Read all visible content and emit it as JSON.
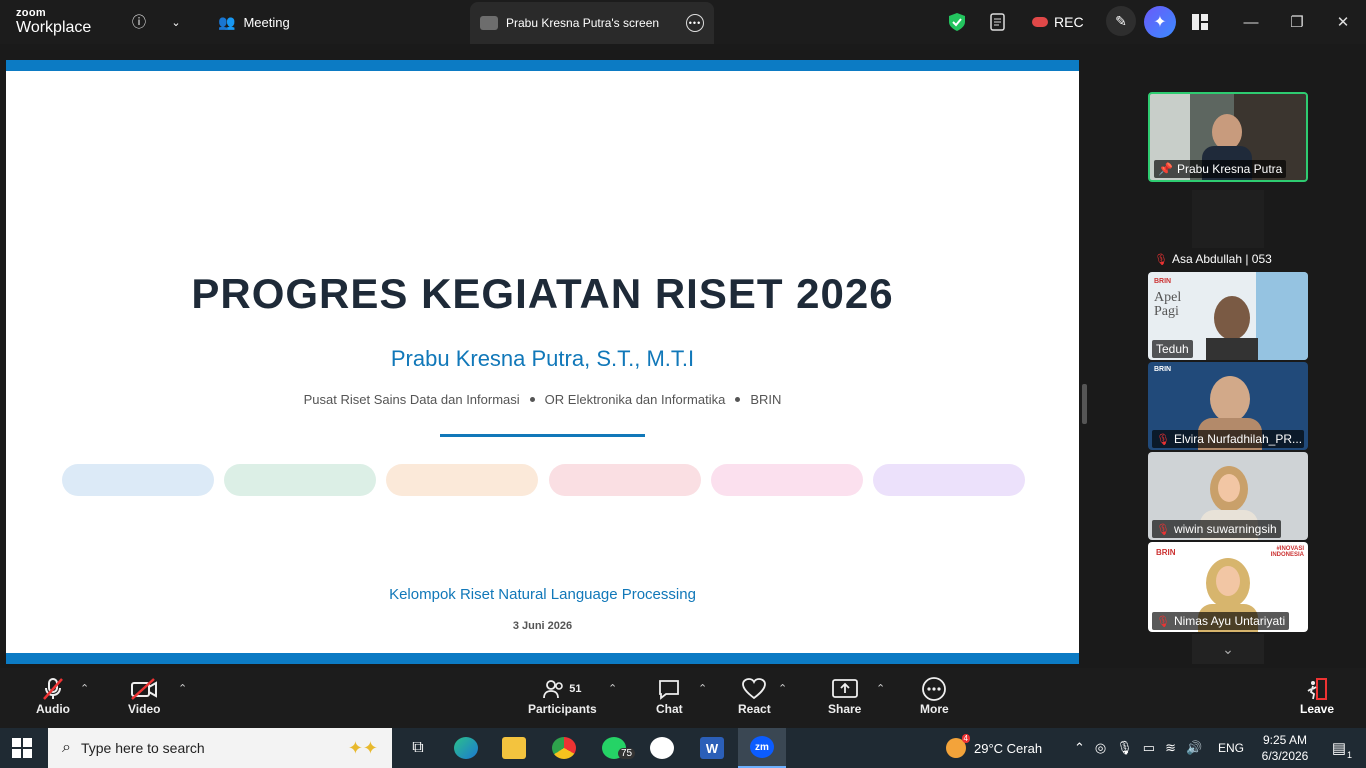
{
  "app": {
    "brand_top": "zoom",
    "brand_bottom": "Workplace"
  },
  "topbar": {
    "meeting_tab": "Meeting",
    "share_tab": "Prabu Kresna Putra's screen",
    "rec_label": "REC"
  },
  "slide": {
    "title": "PROGRES KEGIATAN RISET 2026",
    "author": "Prabu Kresna Putra, S.T., M.T.I",
    "affiliations": [
      "Pusat Riset Sains Data dan Informasi",
      "OR Elektronika dan Informatika",
      "BRIN"
    ],
    "pill_colors": [
      "#dceaf7",
      "#dcefe6",
      "#fbe9d9",
      "#fadfe3",
      "#fbe0ee",
      "#ece1fb"
    ],
    "group": "Kelompok Riset Natural Language Processing",
    "date": "3 Juni  2026"
  },
  "gallery": {
    "active_speaker": "Prabu Kresna Putra",
    "tiles": [
      {
        "name": "Asa Abdullah | 053"
      },
      {
        "name": "Teduh"
      },
      {
        "name": "Elvira Nurfadhilah_PR..."
      },
      {
        "name": "wiwin suwarningsih"
      },
      {
        "name": "Nimas Ayu Untariyati"
      }
    ],
    "tile_text": {
      "apel": "Apel",
      "pagi": "Pagi",
      "brin": "BRIN",
      "inovasi": "#INOVASI INDONESIA"
    }
  },
  "toolbar": {
    "audio": "Audio",
    "video": "Video",
    "participants": "Participants",
    "participants_count": "51",
    "chat": "Chat",
    "react": "React",
    "share": "Share",
    "more": "More",
    "leave": "Leave"
  },
  "taskbar": {
    "search_placeholder": "Type here to search",
    "whatsapp_badge": "75",
    "weather_badge": "4",
    "weather": "29°C  Cerah",
    "language": "ENG",
    "time": "9:25 AM",
    "date": "6/3/2026",
    "notif_count": "1",
    "zoom_label": "zm",
    "word_label": "W"
  }
}
